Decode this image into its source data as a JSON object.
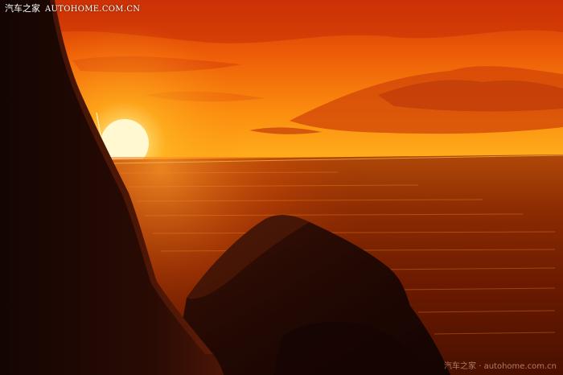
{
  "watermark": {
    "brand_cn": "汽车之家",
    "brand_en": "AUTOHOME.COM.CN",
    "bottom_text": "汽车之家 · autohome.com.cn"
  },
  "colors": {
    "sky_top": "#d83a05",
    "sky_mid": "#f57a0a",
    "sky_horizon": "#ffb21a",
    "sun": "#fff6c8",
    "sea": "#7a1f00",
    "rock": "#1c0703"
  },
  "icons": {
    "sun": "sun-icon"
  }
}
